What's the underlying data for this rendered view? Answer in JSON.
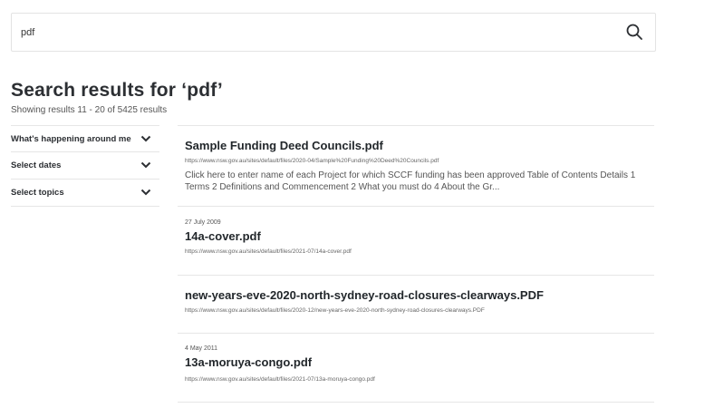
{
  "search": {
    "value": "pdf",
    "button_icon": "search-icon"
  },
  "heading": {
    "title": "Search results for ‘pdf’",
    "count": "Showing results 11 - 20 of 5425 results"
  },
  "filters": [
    {
      "label": "What's happening around me",
      "icon": "chevron-down-icon"
    },
    {
      "label": "Select dates",
      "icon": "chevron-down-icon"
    },
    {
      "label": "Select topics",
      "icon": "chevron-down-icon"
    }
  ],
  "results": [
    {
      "date": "",
      "title": "Sample Funding Deed Councils.pdf",
      "url": "https://www.nsw.gov.au/sites/default/files/2020-04/Sample%20Funding%20Deed%20Councils.pdf",
      "description": "Click here to enter name of each Project for which SCCF funding has been approved Table of Contents Details 1 Terms 2 Definitions and Commencement 2 What you must do 4 About the Gr..."
    },
    {
      "date": "27 July 2009",
      "title": "14a-cover.pdf",
      "url": "https://www.nsw.gov.au/sites/default/files/2021-07/14a-cover.pdf",
      "description": ""
    },
    {
      "date": "",
      "title": "new-years-eve-2020-north-sydney-road-closures-clearways.PDF",
      "url": "https://www.nsw.gov.au/sites/default/files/2020-12/new-years-eve-2020-north-sydney-road-closures-clearways.PDF",
      "description": ""
    },
    {
      "date": "4 May 2011",
      "title": "13a-moruya-congo.pdf",
      "url": "https://www.nsw.gov.au/sites/default/files/2021-07/13a-moruya-congo.pdf",
      "description": ""
    }
  ]
}
